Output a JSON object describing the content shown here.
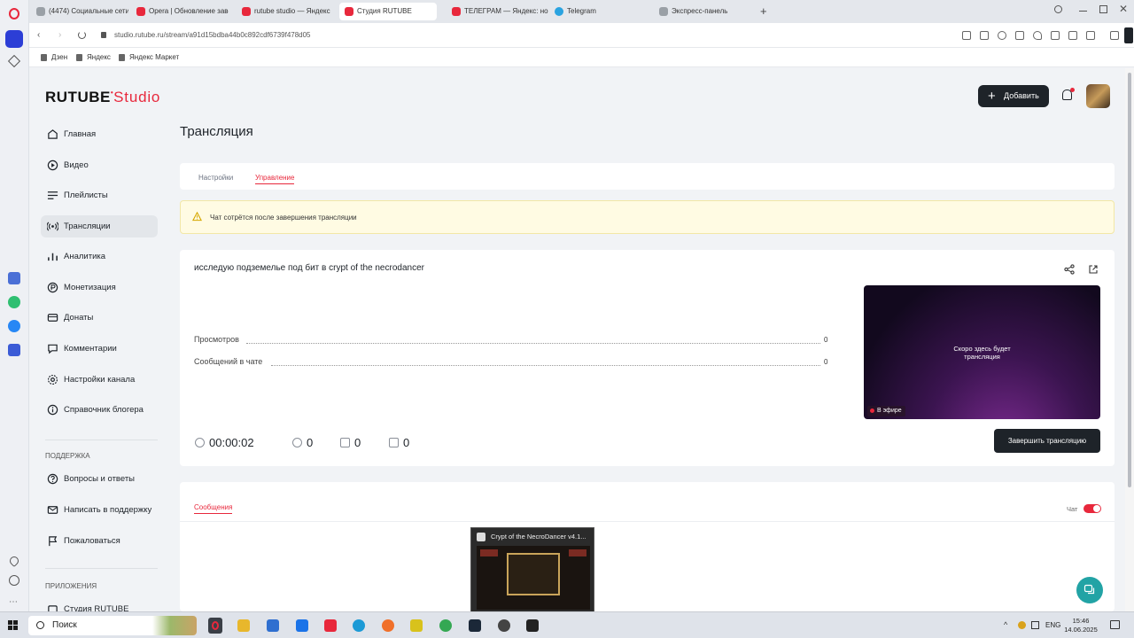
{
  "browser": {
    "tabs": [
      {
        "label": "(4474) Социальные сети",
        "color": "#9aa0a6"
      },
      {
        "label": "Opera | Обновление завс",
        "color": "#e8283c"
      },
      {
        "label": "rutube studio — Яндекс",
        "color": "#e8283c"
      },
      {
        "label": "Студия RUTUBE",
        "color": "#e8283c"
      },
      {
        "label": "ТЕЛЕГРАМ — Яндекс: но",
        "color": "#e8283c"
      },
      {
        "label": "Telegram",
        "color": "#2aa3e0"
      },
      {
        "label": "Экспресс-панель",
        "color": "#9aa0a6"
      }
    ],
    "url": "studio.rutube.ru/stream/a91d15bdba44b0c892cdf6739f478d05",
    "bookmarks": [
      "Дзен",
      "Яндекс",
      "Яндекс Маркет"
    ]
  },
  "app": {
    "logo_main": "RUTUBE",
    "logo_studio": "Studio",
    "add_label": "Добавить",
    "accent": "#e8283c"
  },
  "sidebar": {
    "items": [
      {
        "label": "Главная",
        "icon": "home-icon"
      },
      {
        "label": "Видео",
        "icon": "video-icon"
      },
      {
        "label": "Плейлисты",
        "icon": "playlist-icon"
      },
      {
        "label": "Трансляции",
        "icon": "broadcast-icon",
        "active": true
      },
      {
        "label": "Аналитика",
        "icon": "analytics-icon"
      },
      {
        "label": "Монетизация",
        "icon": "monetization-icon"
      },
      {
        "label": "Донаты",
        "icon": "donate-icon"
      },
      {
        "label": "Комментарии",
        "icon": "comments-icon"
      },
      {
        "label": "Настройки канала",
        "icon": "settings-icon"
      },
      {
        "label": "Справочник блогера",
        "icon": "info-icon"
      }
    ],
    "support_title": "ПОДДЕРЖКА",
    "support_items": [
      {
        "label": "Вопросы и ответы",
        "icon": "question-icon"
      },
      {
        "label": "Написать в поддержку",
        "icon": "mail-icon"
      },
      {
        "label": "Пожаловаться",
        "icon": "flag-icon"
      }
    ],
    "apps_title": "ПРИЛОЖЕНИЯ",
    "apps_items": [
      {
        "label": "Студия RUTUBE",
        "icon": "app-icon"
      }
    ]
  },
  "main": {
    "title": "Трансляция",
    "tabs": [
      "Настройки",
      "Управление"
    ],
    "active_tab": "Управление",
    "warning": "Чат сотрётся после завершения трансляции",
    "stream_title": "исследую подземелье под бит в crypt of the necrodancer",
    "stats": [
      {
        "label": "Просмотров",
        "value": "0"
      },
      {
        "label": "Сообщений в чате",
        "value": "0"
      }
    ],
    "preview_text_1": "Скоро здесь будет",
    "preview_text_2": "трансляция",
    "live_badge": "В эфире",
    "end_button": "Завершить трансляцию",
    "metrics": {
      "duration": "00:00:02",
      "viewers": "0",
      "likes": "0",
      "dislikes": "0"
    },
    "messages_tab": "Сообщения",
    "chat_label": "Чат",
    "chat_enabled": true
  },
  "taskbar": {
    "search_placeholder": "Поиск",
    "preview_title": "Crypt of the NecroDancer v4.1...",
    "lang": "ENG",
    "time": "15:46",
    "date": "14.06.2025"
  }
}
